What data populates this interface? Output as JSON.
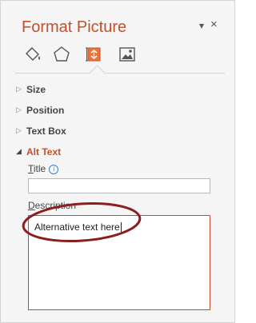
{
  "pane": {
    "title": "Format Picture",
    "pin_glyph": "▾",
    "close_glyph": "×",
    "tabs": [
      {
        "name": "fill-line-icon"
      },
      {
        "name": "effects-icon"
      },
      {
        "name": "size-properties-icon",
        "active": true
      },
      {
        "name": "picture-icon"
      }
    ]
  },
  "sections": {
    "size": "Size",
    "position": "Position",
    "text_box": "Text Box",
    "alt_text": "Alt Text",
    "collapsed_arrow": "▷",
    "expanded_arrow": "◢"
  },
  "alt_text": {
    "title_label_first": "T",
    "title_label_rest": "itle",
    "info_glyph": "i",
    "title_value": "",
    "description_label_first": "D",
    "description_label_rest": "escription",
    "description_value": "Alternative text here"
  },
  "colors": {
    "accent": "#c4502a",
    "highlight_ellipse": "#8b1e1e"
  }
}
